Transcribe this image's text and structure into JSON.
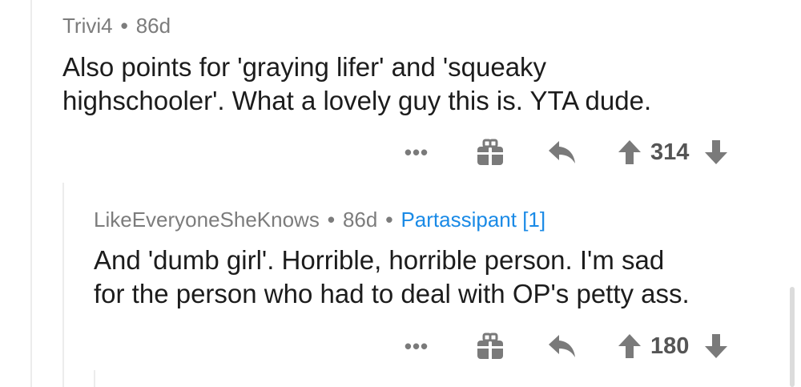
{
  "comments": [
    {
      "author": "Trivi4",
      "age": "86d",
      "flair": "",
      "text_lines": [
        "Also points for 'graying lifer' and 'squeaky",
        "highschooler'. What a lovely guy this is. YTA dude."
      ],
      "score": "314",
      "actions": {
        "more": "•••"
      }
    },
    {
      "author": "LikeEveryoneSheKnows",
      "age": "86d",
      "flair": "Partassipant [1]",
      "text_lines": [
        "And 'dumb girl'. Horrible, horrible person. I'm sad",
        "for the person who had to deal with OP's petty ass."
      ],
      "score": "180",
      "actions": {
        "more": "•••"
      }
    }
  ],
  "separator": "•",
  "colors": {
    "meta_text": "#7c7c7c",
    "flair_text": "#1a8ae6",
    "body_text": "#1c1c1c",
    "icon": "#7a7a7a",
    "thread_line": "#ececec"
  },
  "icons": [
    "more-options-icon",
    "gift-award-icon",
    "reply-arrow-icon",
    "upvote-arrow-icon",
    "downvote-arrow-icon"
  ]
}
